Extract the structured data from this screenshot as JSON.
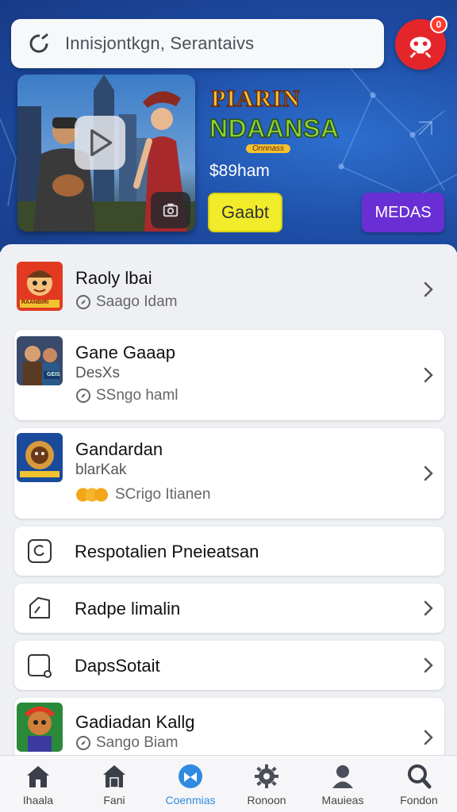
{
  "search": {
    "placeholder": "Innisjontkgn, Serantaivs"
  },
  "header": {
    "notification_count": "0"
  },
  "featured": {
    "logo_line1": "PIARIN",
    "logo_line2": "NDAANSA",
    "logo_ribbon": "Onnnass",
    "price": "$89ham",
    "get_label": "Gaabt",
    "media_label": "MEDAS"
  },
  "list": [
    {
      "title": "Raoly lbai",
      "meta": "Saago Idam",
      "thumb_text": "RAANBIRI"
    },
    {
      "title": "Gane Gaaap",
      "subtitle": "DesXs",
      "meta": "SSngo haml",
      "thumb_text": "GEIS"
    },
    {
      "title": "Gandardan",
      "subtitle": "blarKak",
      "meta": "SCrigo Itianen"
    },
    {
      "title": "Respotalien Pneieatsan"
    },
    {
      "title": "Radpe limalin"
    },
    {
      "title": "DapsSotait"
    },
    {
      "title": "Gadiadan Kallg",
      "meta": "Sango Biam"
    }
  ],
  "nav": [
    {
      "label": "Ihaala",
      "icon": "home-icon"
    },
    {
      "label": "Fani",
      "icon": "store-icon"
    },
    {
      "label": "Coenmias",
      "icon": "games-icon",
      "active": true
    },
    {
      "label": "Ronoon",
      "icon": "settings-icon"
    },
    {
      "label": "Mauieas",
      "icon": "profile-icon"
    },
    {
      "label": "Fondon",
      "icon": "search-icon"
    }
  ],
  "colors": {
    "hero_bg": "#1f4fa8",
    "avatar": "#e4262b",
    "get_button": "#f1ec2a",
    "media_button": "#6a2fd4",
    "active_nav": "#2f8be0"
  }
}
